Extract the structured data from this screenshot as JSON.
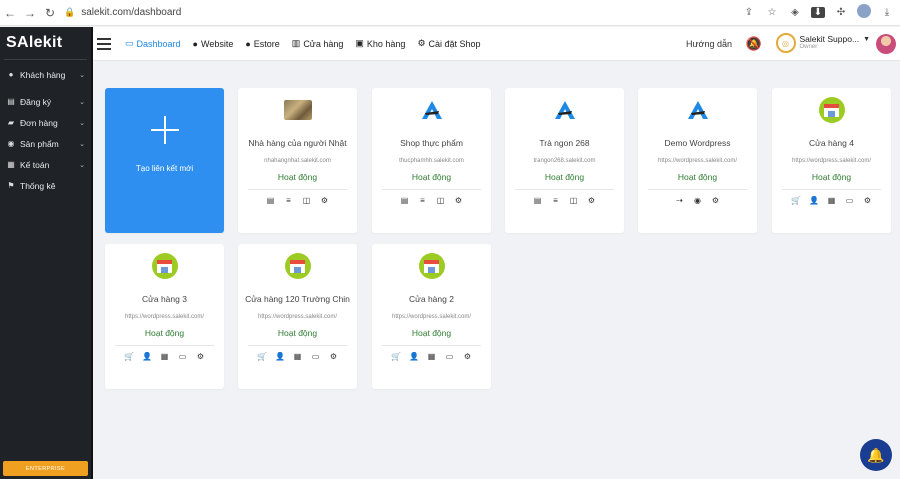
{
  "browser": {
    "url": "salekit.com/dashboard",
    "back_icon": "arrow-left-icon",
    "forward_icon": "arrow-right-icon",
    "reload_icon": "reload-icon"
  },
  "sidebar": {
    "logo": "SAlekit",
    "items": [
      {
        "label": "Khách hàng",
        "icon": "user-icon",
        "has_submenu": true
      },
      {
        "label": "Đăng ký",
        "icon": "form-icon",
        "has_submenu": true
      },
      {
        "label": "Đơn hàng",
        "icon": "truck-icon",
        "has_submenu": true
      },
      {
        "label": "Sản phẩm",
        "icon": "product-icon",
        "has_submenu": true
      },
      {
        "label": "Kế toán",
        "icon": "accounting-icon",
        "has_submenu": true
      },
      {
        "label": "Thống kê",
        "icon": "flag-icon",
        "has_submenu": false
      }
    ],
    "enterprise_label": "ENTERPRISE"
  },
  "topnav": {
    "items": [
      {
        "label": "Dashboard",
        "icon": "monitor-icon",
        "active": true
      },
      {
        "label": "Website",
        "icon": "globe-icon",
        "active": false
      },
      {
        "label": "Estore",
        "icon": "globe-icon",
        "active": false
      },
      {
        "label": "Cửa hàng",
        "icon": "store-icon",
        "active": false
      },
      {
        "label": "Kho hàng",
        "icon": "warehouse-icon",
        "active": false
      },
      {
        "label": "Cài đặt Shop",
        "icon": "gear-icon",
        "active": false
      }
    ],
    "guide_label": "Hướng dẫn",
    "account_name": "Salekit Suppo...",
    "account_role": "Owner"
  },
  "create_card": {
    "label": "Tạo liên kết mới"
  },
  "shops": [
    {
      "title": "Nhà hàng của người Nhật",
      "url": "nhahangnhat.salekit.com",
      "status": "Hoạt động",
      "icon": "food-image",
      "actions": [
        "▤",
        "≡",
        "◫",
        "⚙"
      ]
    },
    {
      "title": "Shop thực phẩm",
      "url": "thucphamhh.salekit.com",
      "status": "Hoạt động",
      "icon": "salekit-logo-icon",
      "actions": [
        "▤",
        "≡",
        "◫",
        "⚙"
      ]
    },
    {
      "title": "Trà ngon 268",
      "url": "trangon268.salekit.com",
      "status": "Hoạt động",
      "icon": "salekit-logo-icon",
      "actions": [
        "▤",
        "≡",
        "◫",
        "⚙"
      ]
    },
    {
      "title": "Demo Wordpress",
      "url": "https://wordpress.salekit.com/",
      "status": "Hoạt động",
      "icon": "salekit-logo-icon",
      "actions": [
        "⇢",
        "◉",
        "⚙"
      ]
    },
    {
      "title": "Cửa hàng 4",
      "url": "https://wordpress.salekit.com/",
      "status": "Hoạt động",
      "icon": "store-badge-icon",
      "actions": [
        "🛒",
        "👤",
        "▦",
        "▭",
        "⚙"
      ]
    },
    {
      "title": "Cửa hàng 3",
      "url": "https://wordpress.salekit.com/",
      "status": "Hoạt động",
      "icon": "store-badge-icon",
      "actions": [
        "🛒",
        "👤",
        "▦",
        "▭",
        "⚙"
      ]
    },
    {
      "title": "Cửa hàng 120 Trường Chin",
      "url": "https://wordpress.salekit.com/",
      "status": "Hoạt động",
      "icon": "store-badge-icon",
      "actions": [
        "🛒",
        "👤",
        "▦",
        "▭",
        "⚙"
      ]
    },
    {
      "title": "Cửa hàng 2",
      "url": "https://wordpress.salekit.com/",
      "status": "Hoạt động",
      "icon": "store-badge-icon",
      "actions": [
        "🛒",
        "👤",
        "▦",
        "▭",
        "⚙"
      ]
    }
  ],
  "colors": {
    "accent": "#1e88e5",
    "create_card": "#2f8ff0",
    "status_active": "#2e7d32",
    "sidebar_bg": "#1f2328",
    "enterprise": "#f0a020",
    "chat_button": "#1a3d91"
  }
}
